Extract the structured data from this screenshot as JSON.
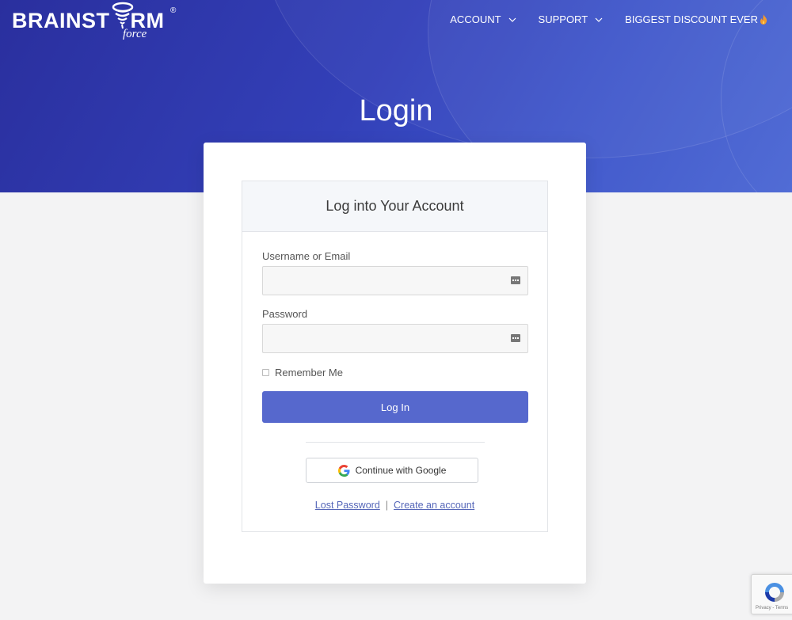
{
  "header": {
    "logo_text": "BRAINST RM",
    "logo_sub": "force",
    "logo_reg": "®",
    "nav": [
      {
        "label": "ACCOUNT",
        "icon": "chevron-down-icon"
      },
      {
        "label": "SUPPORT",
        "icon": "chevron-down-icon"
      },
      {
        "label": "BIGGEST DISCOUNT EVER",
        "icon": "flame-icon"
      }
    ]
  },
  "page": {
    "title": "Login"
  },
  "form": {
    "heading": "Log into Your Account",
    "username_label": "Username or Email",
    "username_value": "",
    "password_label": "Password",
    "password_value": "",
    "remember_label": "Remember Me",
    "login_button": "Log In",
    "google_button": "Continue with Google",
    "lost_password": "Lost Password",
    "separator": "|",
    "create_account": "Create an account"
  },
  "recaptcha": {
    "text": "Privacy - Terms"
  },
  "colors": {
    "hero_start": "#2a2f9e",
    "hero_end": "#4a66d4",
    "button": "#5668cd",
    "link": "#5566b8"
  }
}
